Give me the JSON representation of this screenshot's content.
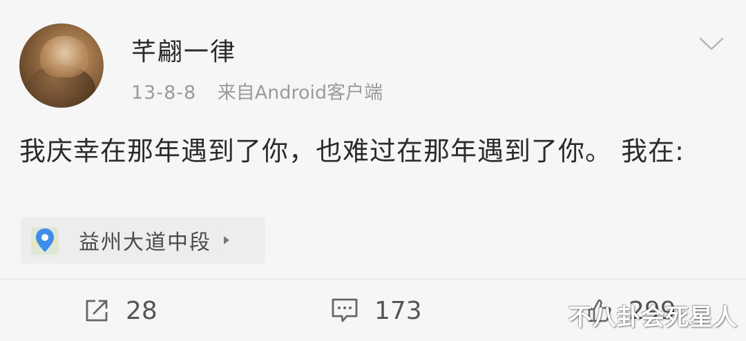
{
  "post": {
    "username": "芊翩一律",
    "date": "13-8-8",
    "source": "来自Android客户端",
    "content": "我庆幸在那年遇到了你，也难过在那年遇到了你。 我在:",
    "location": "益州大道中段"
  },
  "actions": {
    "repost_count": "28",
    "comment_count": "173",
    "like_count": "299"
  },
  "watermark": "不八卦会死星人",
  "icons": {
    "menu": "chevron-down-icon",
    "location": "location-pin-icon",
    "repost": "repost-icon",
    "comment": "comment-icon",
    "like": "thumbs-up-icon"
  },
  "colors": {
    "background": "#f6f6f6",
    "pin": "#3d8eea",
    "meta_text": "#9a9a9a"
  }
}
